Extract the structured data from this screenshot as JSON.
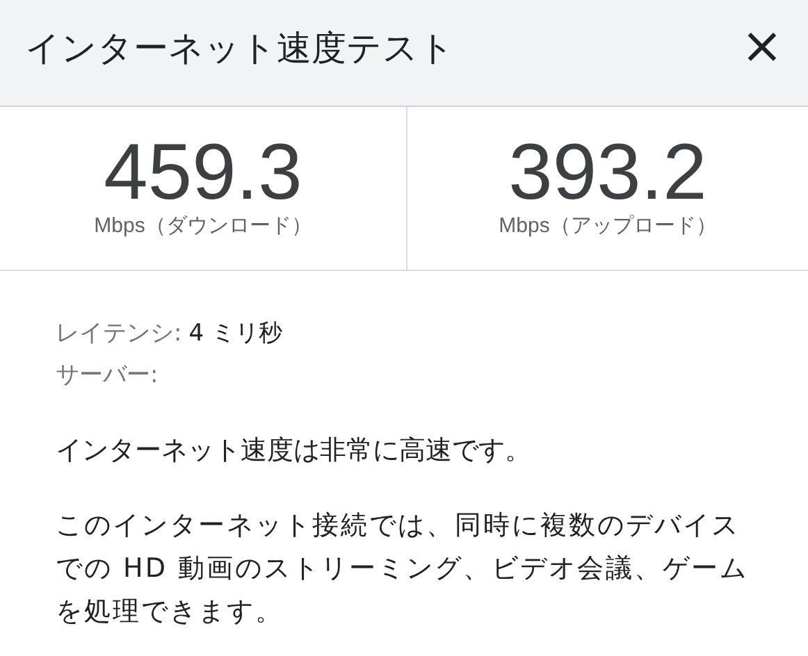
{
  "dialog": {
    "title": "インターネット速度テスト",
    "close_icon": "×"
  },
  "results": [
    {
      "value": "459.3",
      "unit": "Mbps（ダウンロード）"
    },
    {
      "value": "393.2",
      "unit": "Mbps（アップロード）"
    }
  ],
  "details": [
    {
      "label": "レイテンシ:",
      "value": "4 ミリ秒"
    },
    {
      "label": "サーバー:"
    }
  ],
  "summary": "インターネット速度は非常に高速です。",
  "description": "このインターネット接続では、同時に複数のデバイスでの HD 動画のストリーミング、ビデオ会議、ゲームを処理できます。"
}
